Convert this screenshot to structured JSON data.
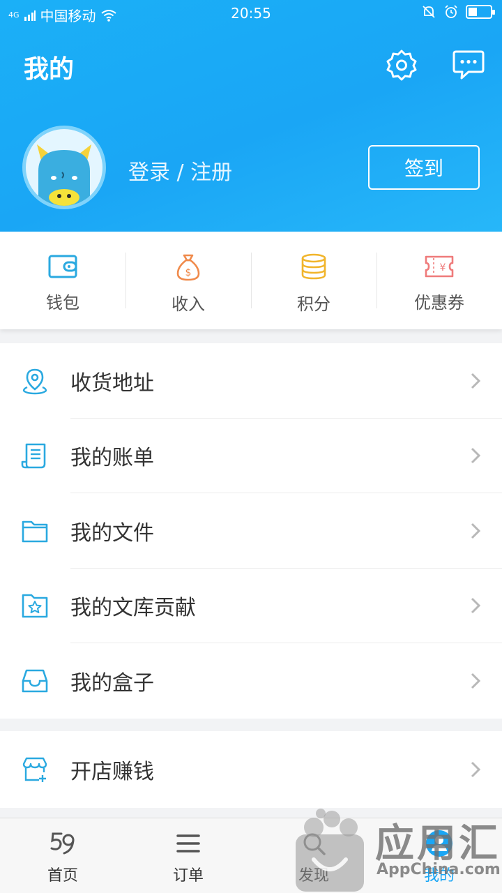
{
  "status_bar": {
    "network": "4G",
    "carrier": "中国移动",
    "time": "20:55"
  },
  "header": {
    "title": "我的",
    "login_text": "登录 / 注册",
    "signin_label": "签到"
  },
  "quick_items": [
    {
      "label": "钱包",
      "icon": "wallet-icon",
      "color": "#2aa9e0"
    },
    {
      "label": "收入",
      "icon": "money-bag-icon",
      "color": "#f08a4b"
    },
    {
      "label": "积分",
      "icon": "coins-icon",
      "color": "#f1b52c"
    },
    {
      "label": "优惠券",
      "icon": "coupon-icon",
      "color": "#ef7b7b"
    }
  ],
  "menu": [
    {
      "label": "收货地址",
      "icon": "location-pin-icon"
    },
    {
      "label": "我的账单",
      "icon": "bill-icon"
    },
    {
      "label": "我的文件",
      "icon": "folder-icon"
    },
    {
      "label": "我的文库贡献",
      "icon": "star-folder-icon"
    },
    {
      "label": "我的盒子",
      "icon": "inbox-icon"
    }
  ],
  "menu2": [
    {
      "label": "开店赚钱",
      "icon": "store-icon"
    }
  ],
  "tabs": [
    {
      "label": "首页",
      "icon": "home-59-icon"
    },
    {
      "label": "订单",
      "icon": "list-icon"
    },
    {
      "label": "发现",
      "icon": "discover-icon"
    },
    {
      "label": "我的",
      "icon": "profile-icon",
      "active": true
    }
  ],
  "watermark": {
    "text_cn": "应用汇",
    "text_en": "AppChina.com"
  },
  "colors": {
    "primary": "#1aa6f5",
    "menu_icon": "#2aa9e0"
  }
}
